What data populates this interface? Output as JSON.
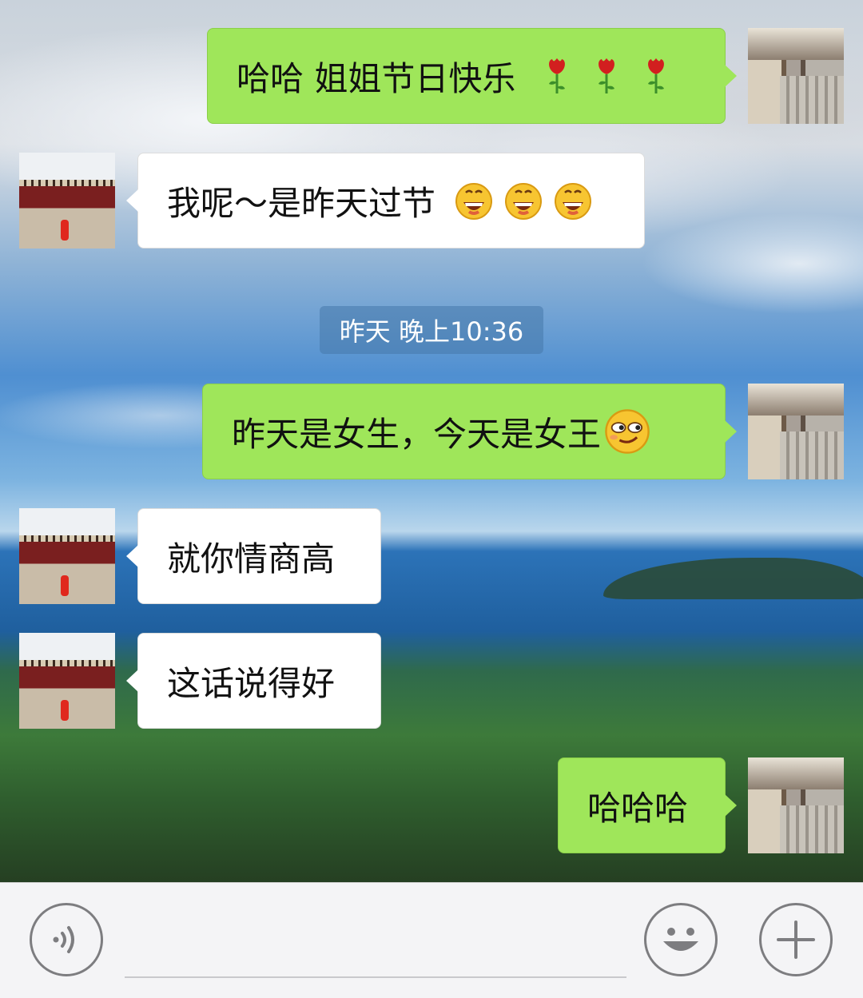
{
  "chat": {
    "messages": [
      {
        "direction": "sent",
        "text": "哈哈 姐姐节日快乐",
        "emojis": [
          "rose",
          "rose",
          "rose"
        ]
      },
      {
        "direction": "received",
        "text": "我呢～是昨天过节",
        "emojis": [
          "grin",
          "grin",
          "grin"
        ]
      },
      {
        "direction": "sent",
        "text": "昨天是女生，今天是女王",
        "emojis": [
          "smirk"
        ]
      },
      {
        "direction": "received",
        "text": "就你情商高",
        "emojis": []
      },
      {
        "direction": "received",
        "text": "这话说得好",
        "emojis": []
      },
      {
        "direction": "sent",
        "text": "哈哈哈",
        "emojis": []
      }
    ],
    "timestamp": "昨天 晚上10:36"
  },
  "input_bar": {
    "voice_icon": "voice-icon",
    "emoji_icon": "emoji-face-icon",
    "plus_icon": "plus-icon",
    "input_value": "",
    "input_placeholder": ""
  },
  "colors": {
    "sent_bubble": "#9fe65a",
    "received_bubble": "#ffffff",
    "timestamp_bg": "#4678aa",
    "input_bar_bg": "#f4f4f6"
  }
}
